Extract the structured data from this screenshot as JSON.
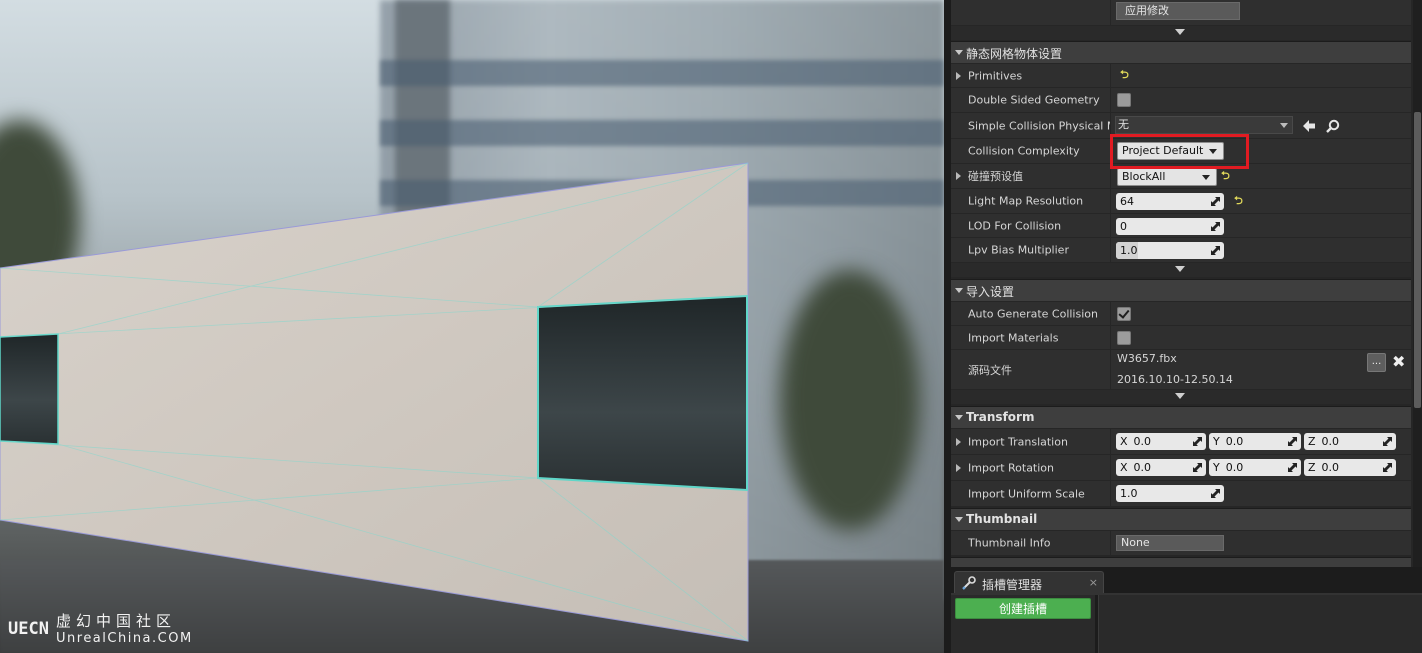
{
  "watermark": {
    "cn": "虚幻中国社区",
    "en": "UnrealChina.COM"
  },
  "details": {
    "apply_changes_label": "应用修改",
    "static_mesh_section": {
      "title": "静态网格物体设置",
      "primitives_label": "Primitives",
      "double_sided_label": "Double Sided Geometry",
      "double_sided_checked": false,
      "simple_collision_label": "Simple Collision Physical Material",
      "simple_collision_value": "无",
      "collision_complexity_label": "Collision Complexity",
      "collision_complexity_value": "Project Default",
      "collision_preset_label": "碰撞预设值",
      "collision_preset_value": "BlockAll",
      "light_map_label": "Light Map Resolution",
      "light_map_value": "64",
      "lod_collision_label": "LOD For Collision",
      "lod_collision_value": "0",
      "lpv_bias_label": "Lpv Bias Multiplier",
      "lpv_bias_value": "1.0",
      "lpv_bias_fill": 0.2
    },
    "import_section": {
      "title": "导入设置",
      "auto_collision_label": "Auto Generate Collision",
      "auto_collision_checked": true,
      "import_materials_label": "Import Materials",
      "import_materials_checked": false,
      "source_file_label": "源码文件",
      "source_file_name": "W3657.fbx",
      "source_file_date": "2016.10.10-12.50.14",
      "browse_label": "..."
    },
    "transform_section": {
      "title": "Transform",
      "translation_label": "Import Translation",
      "rotation_label": "Import Rotation",
      "scale_label": "Import Uniform Scale",
      "axis_x": "X",
      "axis_y": "Y",
      "axis_z": "Z",
      "translation": {
        "x": "0.0",
        "y": "0.0",
        "z": "0.0"
      },
      "rotation": {
        "x": "0.0",
        "y": "0.0",
        "z": "0.0"
      },
      "scale": "1.0"
    },
    "thumbnail_section": {
      "title": "Thumbnail",
      "info_label": "Thumbnail Info",
      "info_value": "None"
    }
  },
  "socket_manager": {
    "tab_label": "插槽管理器",
    "tab_close": "×",
    "create_socket_label": "创建插槽"
  }
}
